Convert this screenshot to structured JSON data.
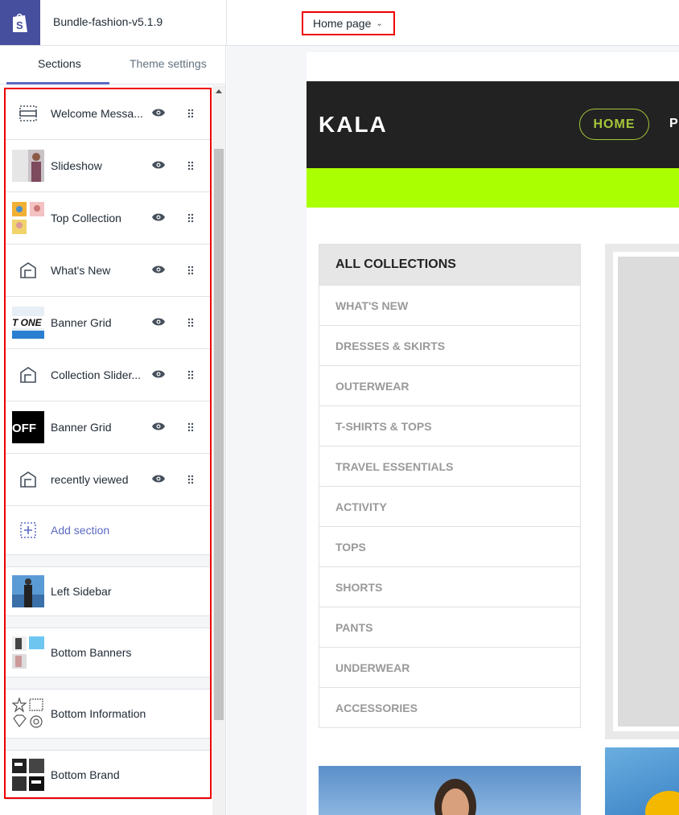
{
  "topbar": {
    "theme_name": "Bundle-fashion-v5.1.9",
    "page_selector": "Home page"
  },
  "tabs": {
    "sections": "Sections",
    "theme_settings": "Theme settings"
  },
  "sections": [
    {
      "label": "Welcome Messa...",
      "icon": "welcome-message-icon"
    },
    {
      "label": "Slideshow",
      "icon": "slideshow-thumbnail"
    },
    {
      "label": "Top Collection",
      "icon": "top-collection-thumbnail"
    },
    {
      "label": "What's New",
      "icon": "section-house-icon"
    },
    {
      "label": "Banner Grid",
      "icon": "banner-grid-thumbnail"
    },
    {
      "label": "Collection Slider...",
      "icon": "section-house-icon"
    },
    {
      "label": "Banner Grid",
      "icon": "banner-grid-off-thumbnail"
    },
    {
      "label": "recently viewed",
      "icon": "section-house-icon"
    }
  ],
  "add_section": "Add section",
  "fixed_sections": [
    {
      "label": "Left Sidebar"
    },
    {
      "label": "Bottom Banners"
    },
    {
      "label": "Bottom Information"
    },
    {
      "label": "Bottom Brand"
    }
  ],
  "preview": {
    "brand": "KALA",
    "nav_home": "HOME",
    "nav_next": "P",
    "collections_title": "ALL COLLECTIONS",
    "collections": [
      "WHAT'S NEW",
      "DRESSES & SKIRTS",
      "OUTERWEAR",
      "T-SHIRTS & TOPS",
      "TRAVEL ESSENTIALS",
      "ACTIVITY",
      "TOPS",
      "SHORTS",
      "PANTS",
      "UNDERWEAR",
      "ACCESSORIES"
    ]
  },
  "colors": {
    "accent": "#5c6ac4",
    "highlight": "#ee0000",
    "green_bar": "#aaff00",
    "nav_green": "#a4c639"
  }
}
